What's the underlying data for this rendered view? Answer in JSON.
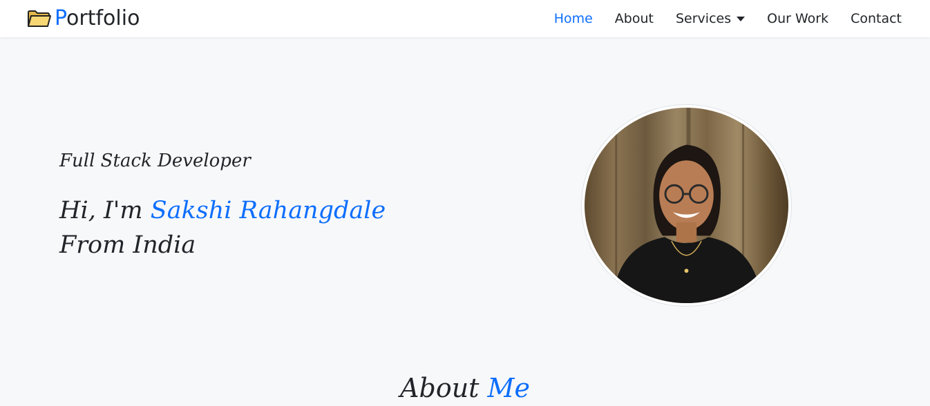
{
  "brand": {
    "first_letter": "P",
    "rest": "ortfolio",
    "icon": "folder-icon"
  },
  "nav": {
    "items": [
      {
        "label": "Home",
        "active": true
      },
      {
        "label": "About"
      },
      {
        "label": "Services",
        "dropdown": true
      },
      {
        "label": "Our Work"
      },
      {
        "label": "Contact"
      }
    ]
  },
  "hero": {
    "subtitle": "Full Stack Developer",
    "greeting": "Hi, I'm",
    "name": "Sakshi Rahangdale",
    "location": "From India"
  },
  "about": {
    "heading_first": "About",
    "heading_second": "Me"
  },
  "colors": {
    "accent": "#0d6efd",
    "text": "#212529",
    "background": "#f7f8fa"
  }
}
